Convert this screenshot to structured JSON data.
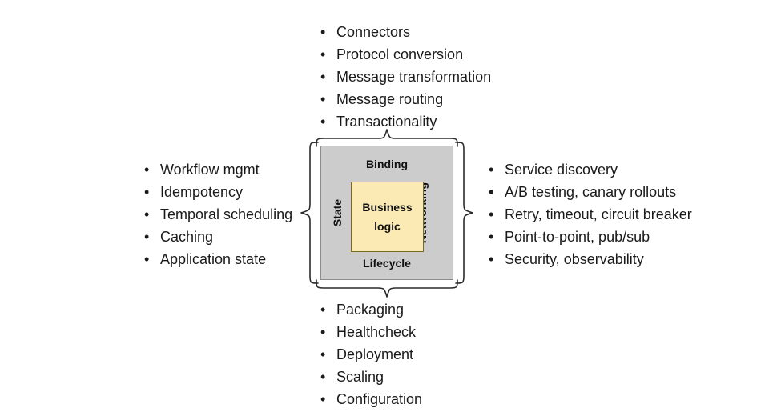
{
  "diagram": {
    "title_present": false,
    "center": {
      "outer_label_top": "Binding",
      "outer_label_bottom": "Lifecycle",
      "outer_label_left": "State",
      "outer_label_right": "Networking",
      "inner_label": "Business logic",
      "colors": {
        "outer_fill": "#cccccc",
        "outer_stroke": "#8c8c8c",
        "inner_fill": "#fbeab4",
        "inner_stroke": "#7a6a20",
        "text": "#111111",
        "brace_stroke": "#2b2b2b",
        "background": "#ffffff"
      }
    },
    "lists": {
      "top": {
        "anchor": "Binding",
        "items": [
          "Connectors",
          "Protocol conversion",
          "Message transformation",
          "Message routing",
          "Transactionality"
        ]
      },
      "left": {
        "anchor": "State",
        "items": [
          "Workflow mgmt",
          "Idempotency",
          "Temporal scheduling",
          "Caching",
          "Application state"
        ]
      },
      "right": {
        "anchor": "Networking",
        "items": [
          "Service discovery",
          "A/B testing, canary rollouts",
          "Retry, timeout, circuit breaker",
          "Point-to-point, pub/sub",
          "Security, observability"
        ]
      },
      "bottom": {
        "anchor": "Lifecycle",
        "items": [
          "Packaging",
          "Healthcheck",
          "Deployment",
          "Scaling",
          "Configuration"
        ]
      }
    }
  }
}
